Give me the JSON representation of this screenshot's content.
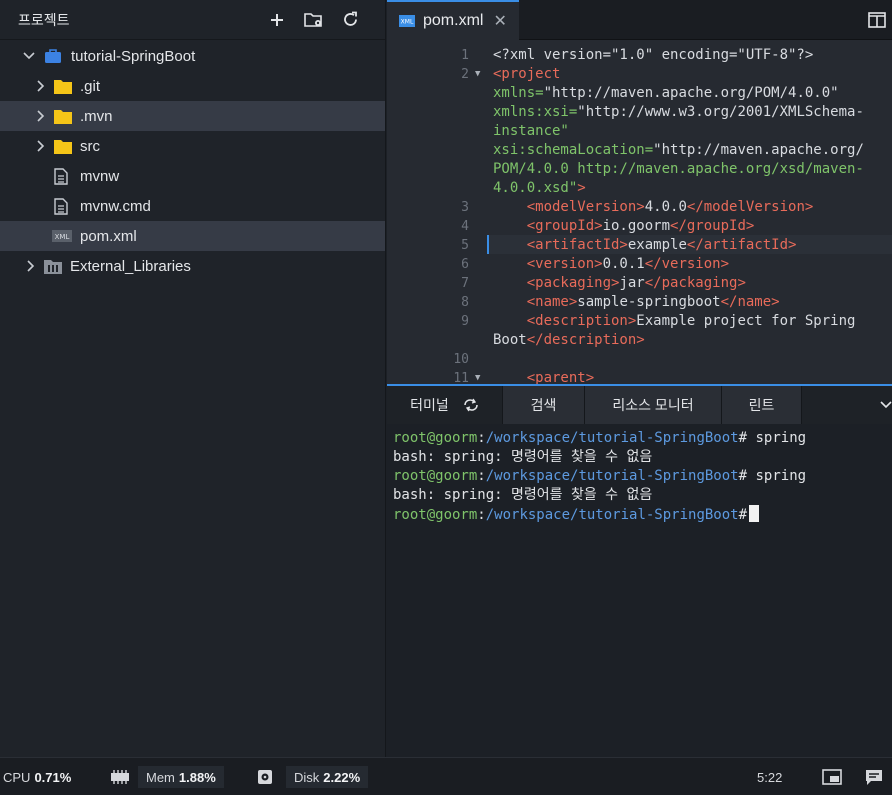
{
  "sidebar": {
    "title": "프로젝트",
    "tree": [
      {
        "label": "tutorial-SpringBoot",
        "type": "project"
      },
      {
        "label": ".git",
        "type": "folder"
      },
      {
        "label": ".mvn",
        "type": "folder"
      },
      {
        "label": "src",
        "type": "folder"
      },
      {
        "label": "mvnw",
        "type": "file"
      },
      {
        "label": "mvnw.cmd",
        "type": "file"
      },
      {
        "label": "pom.xml",
        "type": "xml"
      },
      {
        "label": "External_Libraries",
        "type": "library"
      }
    ]
  },
  "editor": {
    "tab_label": "pom.xml",
    "tab_icon_text": "XML",
    "lines": [
      {
        "n": "1"
      },
      {
        "n": "2"
      },
      {
        "n": ""
      },
      {
        "n": ""
      },
      {
        "n": ""
      },
      {
        "n": ""
      },
      {
        "n": ""
      },
      {
        "n": "3"
      },
      {
        "n": "4"
      },
      {
        "n": "5"
      },
      {
        "n": "6"
      },
      {
        "n": "7"
      },
      {
        "n": "8"
      },
      {
        "n": "9"
      },
      {
        "n": ""
      },
      {
        "n": "10"
      },
      {
        "n": "11"
      }
    ],
    "code": {
      "l1": "<?xml version=\"1.0\" encoding=\"UTF-8\"?>",
      "l2_tag": "<project",
      "l2a_attr": "xmlns=",
      "l2a_val": "\"http://maven.apache.org/POM/4.0.0\"",
      "l2b_attr": "xmlns:xsi=",
      "l2b_val": "\"http://www.w3.org/2001/XMLSchema-",
      "l2c_attr": "instance\"",
      "l2d_attr": "xsi:schemaLocation=",
      "l2d_val": "\"http://maven.apache.org/",
      "l2e": "POM/4.0.0 http://maven.apache.org/xsd/maven-",
      "l2f": "4.0.0.xsd\"",
      "l2f_close": ">",
      "l3_open": "<modelVersion>",
      "l3_val": "4.0.0",
      "l3_close": "</modelVersion>",
      "l4_open": "<groupId>",
      "l4_val": "io.goorm",
      "l4_close": "</groupId>",
      "l5_open": "<artifactId>",
      "l5_val": "example",
      "l5_close": "</artifactId>",
      "l6_open": "<version>",
      "l6_val": "0.0.1",
      "l6_close": "</version>",
      "l7_open": "<packaging>",
      "l7_val": "jar",
      "l7_close": "</packaging>",
      "l8_open": "<name>",
      "l8_val": "sample-springboot",
      "l8_close": "</name>",
      "l9_open": "<description>",
      "l9_val": "Example project for Spring",
      "l9b_val": "Boot",
      "l9_close": "</description>",
      "l11": "<parent>"
    }
  },
  "panel": {
    "tabs": [
      "터미널",
      "검색",
      "리소스 모니터",
      "린트"
    ]
  },
  "terminal": {
    "user": "root@goorm",
    "sep": ":",
    "path": "/workspace/tutorial-SpringBoot",
    "prompt": "#",
    "cmd": " spring",
    "error": "bash: spring: 명령어를 찾을 수 없음"
  },
  "status": {
    "cpu_label": "CPU",
    "cpu_value": "0.71%",
    "mem_label": "Mem",
    "mem_value": "1.88%",
    "disk_label": "Disk",
    "disk_value": "2.22%",
    "time": "5:22"
  },
  "colors": {
    "accent": "#3a8ee6",
    "folder": "#f5c518",
    "project": "#3c82e3",
    "tag": "#e86b5a",
    "attr": "#7fc46a"
  }
}
